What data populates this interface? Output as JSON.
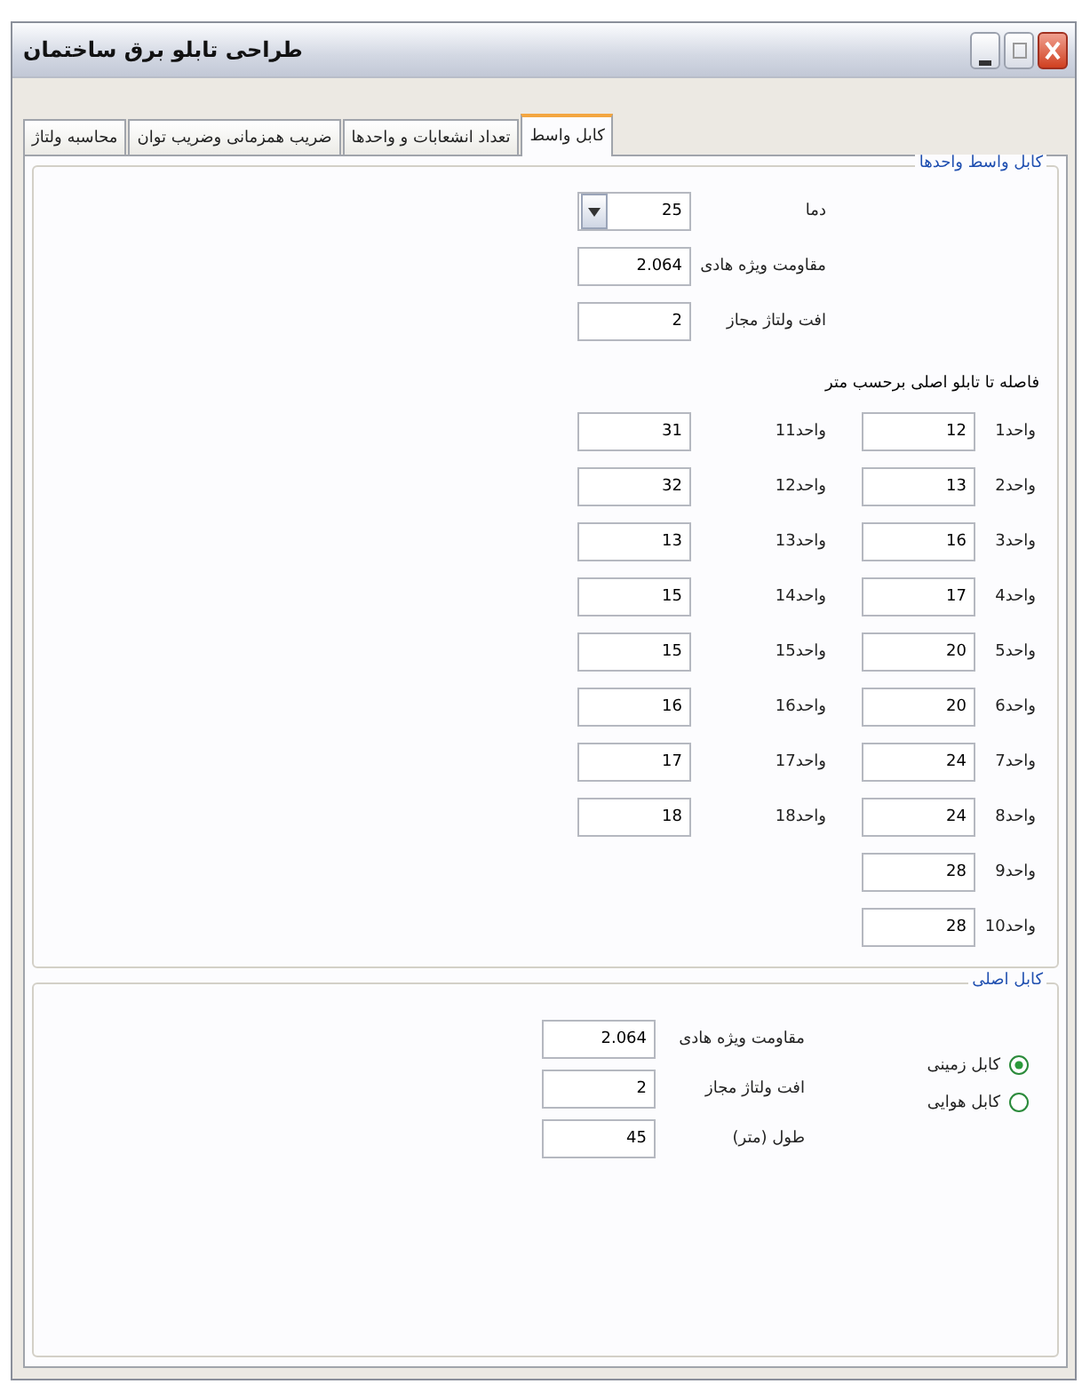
{
  "window": {
    "title": "طراحی تابلو برق ساختمان"
  },
  "tabs": [
    {
      "label": "کابل واسط",
      "selected": true
    },
    {
      "label": "تعداد انشعابات و واحدها",
      "selected": false
    },
    {
      "label": "ضریب همزمانی وضریب توان",
      "selected": false
    },
    {
      "label": "محاسبه ولتاژ",
      "selected": false
    }
  ],
  "unit_cable_group": {
    "title": "کابل واسط واحدها",
    "settings": [
      {
        "kind": "dropdown",
        "label": "دما",
        "value": "25"
      },
      {
        "kind": "text",
        "label": "مقاومت ویژه هادی",
        "value": "2.064"
      },
      {
        "kind": "text",
        "label": "افت ولتاژ مجاز",
        "value": "2"
      }
    ],
    "distance_heading": "فاصله تا تابلو اصلی برحسب متر",
    "units": [
      {
        "label": "واحد1",
        "value": "12"
      },
      {
        "label": "واحد2",
        "value": "13"
      },
      {
        "label": "واحد3",
        "value": "16"
      },
      {
        "label": "واحد4",
        "value": "17"
      },
      {
        "label": "واحد5",
        "value": "20"
      },
      {
        "label": "واحد6",
        "value": "20"
      },
      {
        "label": "واحد7",
        "value": "24"
      },
      {
        "label": "واحد8",
        "value": "24"
      },
      {
        "label": "واحد9",
        "value": "28"
      },
      {
        "label": "واحد10",
        "value": "28"
      },
      {
        "label": "واحد11",
        "value": "31"
      },
      {
        "label": "واحد12",
        "value": "32"
      },
      {
        "label": "واحد13",
        "value": "13"
      },
      {
        "label": "واحد14",
        "value": "15"
      },
      {
        "label": "واحد15",
        "value": "15"
      },
      {
        "label": "واحد16",
        "value": "16"
      },
      {
        "label": "واحد17",
        "value": "17"
      },
      {
        "label": "واحد18",
        "value": "18"
      }
    ]
  },
  "main_cable_group": {
    "title": "کابل اصلی",
    "cable_types": [
      {
        "label": "کابل زمینی",
        "selected": true
      },
      {
        "label": "کابل هوایی",
        "selected": false
      }
    ],
    "settings": [
      {
        "label": "مقاومت ویژه هادی",
        "value": "2.064"
      },
      {
        "label": "افت ولتاژ مجاز",
        "value": "2"
      },
      {
        "label": "طول (متر)",
        "value": "45"
      }
    ]
  }
}
